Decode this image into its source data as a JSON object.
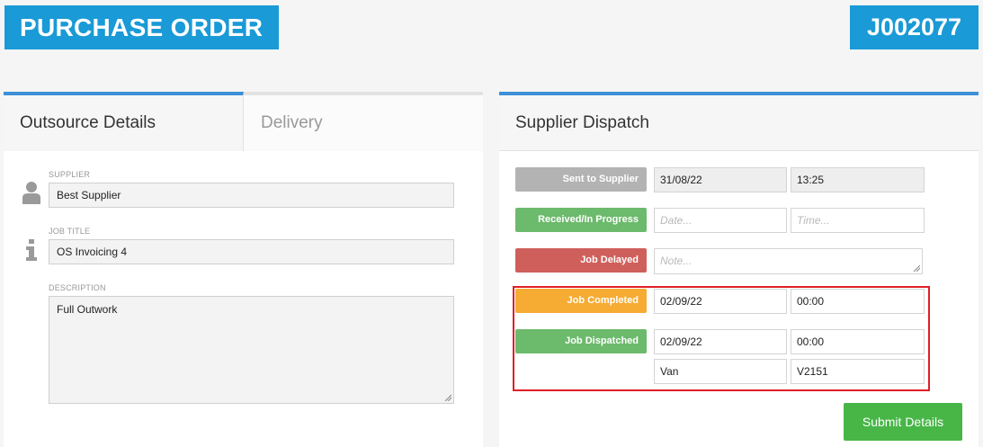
{
  "header": {
    "title": "PURCHASE ORDER",
    "job_number": "J002077"
  },
  "left_panel": {
    "tabs": [
      {
        "label": "Outsource Details",
        "active": true
      },
      {
        "label": "Delivery",
        "active": false
      }
    ],
    "supplier": {
      "label": "SUPPLIER",
      "value": "Best Supplier",
      "icon": "user-icon"
    },
    "job_title": {
      "label": "JOB TITLE",
      "value": "OS Invoicing 4",
      "icon": "info-icon"
    },
    "description": {
      "label": "DESCRIPTION",
      "value": "Full Outwork"
    }
  },
  "right_panel": {
    "title": "Supplier Dispatch",
    "rows": {
      "sent": {
        "label": "Sent to Supplier",
        "date": "31/08/22",
        "time": "13:25",
        "color": "#b3b3b3"
      },
      "received": {
        "label": "Received/In Progress",
        "date_placeholder": "Date...",
        "time_placeholder": "Time...",
        "color": "#6cba6c"
      },
      "delayed": {
        "label": "Job Delayed",
        "note_placeholder": "Note...",
        "color": "#cf5f5b"
      },
      "completed": {
        "label": "Job Completed",
        "date": "02/09/22",
        "time": "00:00",
        "color": "#f6ab33"
      },
      "dispatched": {
        "label": "Job Dispatched",
        "date": "02/09/22",
        "time": "00:00",
        "method": "Van",
        "reference": "V2151",
        "color": "#6cba6c"
      }
    },
    "submit_label": "Submit Details"
  },
  "colors": {
    "brand": "#1a9ad6",
    "tab_accent": "#3d8fd6",
    "submit": "#47b647",
    "highlight": "#e01f26"
  }
}
